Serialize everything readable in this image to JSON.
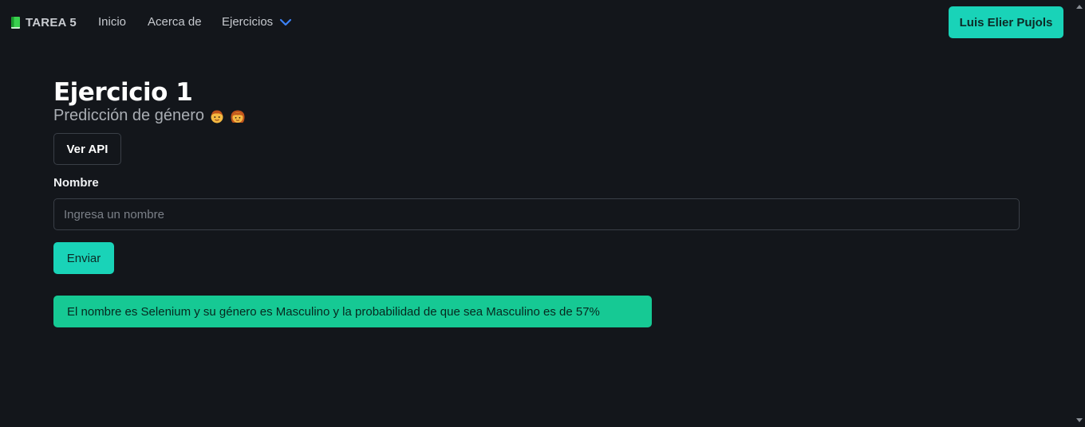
{
  "navbar": {
    "brand": "TAREA 5",
    "links": {
      "inicio": "Inicio",
      "acerca": "Acerca de",
      "ejercicios": "Ejercicios"
    },
    "user_button": "Luis Elier Pujols"
  },
  "main": {
    "title": "Ejercicio 1",
    "subtitle": "Predicción de género",
    "api_button": "Ver API",
    "field_label": "Nombre",
    "input_placeholder": "Ingresa un nombre",
    "input_value": "",
    "submit_button": "Enviar",
    "result": "El nombre es Selenium y su género es Masculino y la probabilidad de que sea Masculino es de 57%"
  },
  "icons": {
    "brand": "book-icon",
    "dropdown": "chevron-down-icon",
    "emoji_1": "boy-emoji-icon",
    "emoji_2": "girl-emoji-icon"
  },
  "colors": {
    "background": "#13161b",
    "accent": "#19d3b8",
    "success": "#16c994",
    "chevron": "#3b82f6"
  }
}
